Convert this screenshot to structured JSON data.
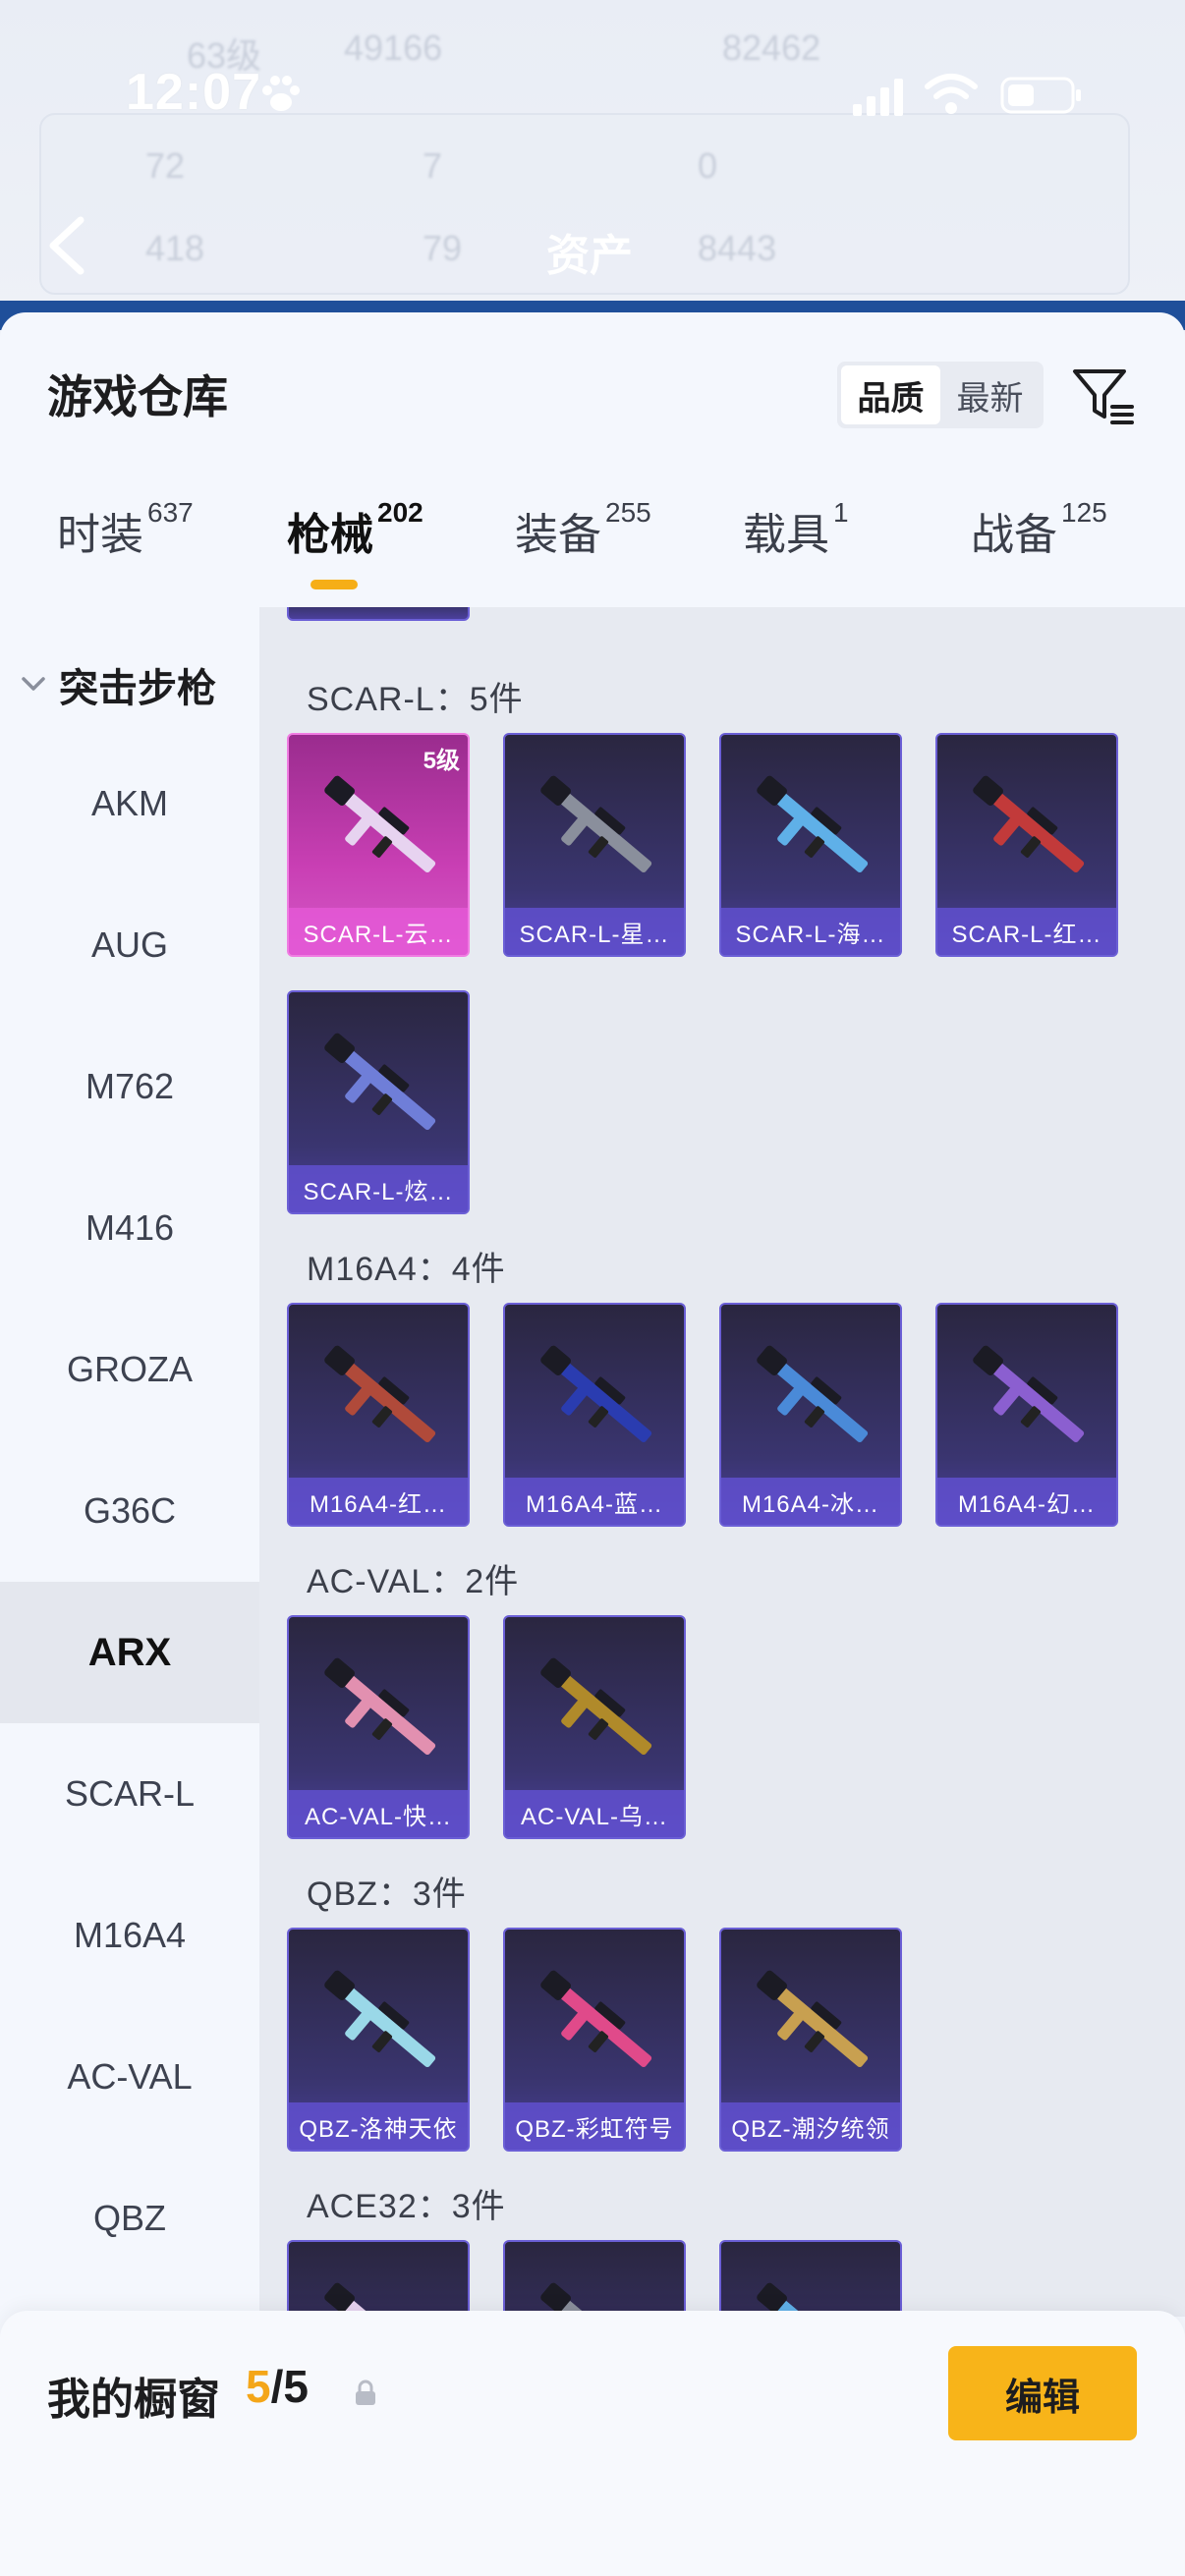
{
  "status_bar": {
    "time": "12:07"
  },
  "background_header": {
    "title": "资产",
    "blur_stats": [
      "63级",
      "49166",
      "82462",
      "72",
      "7",
      "0",
      "418",
      "79",
      "8443"
    ]
  },
  "warehouse": {
    "title": "游戏仓库",
    "sort_options": [
      {
        "label": "品质",
        "active": true
      },
      {
        "label": "最新",
        "active": false
      }
    ],
    "tabs": [
      {
        "label": "时装",
        "count": "637",
        "active": false
      },
      {
        "label": "枪械",
        "count": "202",
        "active": true
      },
      {
        "label": "装备",
        "count": "255",
        "active": false
      },
      {
        "label": "载具",
        "count": "1",
        "active": false
      },
      {
        "label": "战备",
        "count": "125",
        "active": false
      }
    ]
  },
  "sidebar": {
    "group_label": "突击步枪",
    "items": [
      "AKM",
      "AUG",
      "M762",
      "M416",
      "GROZA",
      "G36C",
      "ARX",
      "SCAR-L",
      "M16A4",
      "AC-VAL",
      "QBZ"
    ],
    "active": "ARX"
  },
  "sections": [
    {
      "title": "SCAR-L：5件",
      "items": [
        {
          "label": "SCAR-L-云…",
          "level": "5级",
          "style": "pink"
        },
        {
          "label": "SCAR-L-星…"
        },
        {
          "label": "SCAR-L-海…"
        },
        {
          "label": "SCAR-L-红…"
        },
        {
          "label": "SCAR-L-炫…"
        }
      ]
    },
    {
      "title": "M16A4：4件",
      "items": [
        {
          "label": "M16A4-红…"
        },
        {
          "label": "M16A4-蓝…"
        },
        {
          "label": "M16A4-冰…"
        },
        {
          "label": "M16A4-幻…"
        }
      ]
    },
    {
      "title": "AC-VAL：2件",
      "items": [
        {
          "label": "AC-VAL-快…"
        },
        {
          "label": "AC-VAL-乌…"
        }
      ]
    },
    {
      "title": "QBZ：3件",
      "items": [
        {
          "label": "QBZ-洛神天依"
        },
        {
          "label": "QBZ-彩虹符号"
        },
        {
          "label": "QBZ-潮汐统领"
        }
      ]
    },
    {
      "title": "ACE32：3件",
      "items": [
        {
          "label": ""
        },
        {
          "label": ""
        },
        {
          "label": ""
        }
      ]
    }
  ],
  "showcase": {
    "title": "我的橱窗",
    "current": "5",
    "separator": "/",
    "total": "5",
    "edit_label": "编辑"
  },
  "colors": {
    "accent": "#f8b419",
    "card_border": "#6b5fd6",
    "legendary": "#c93fb4"
  }
}
